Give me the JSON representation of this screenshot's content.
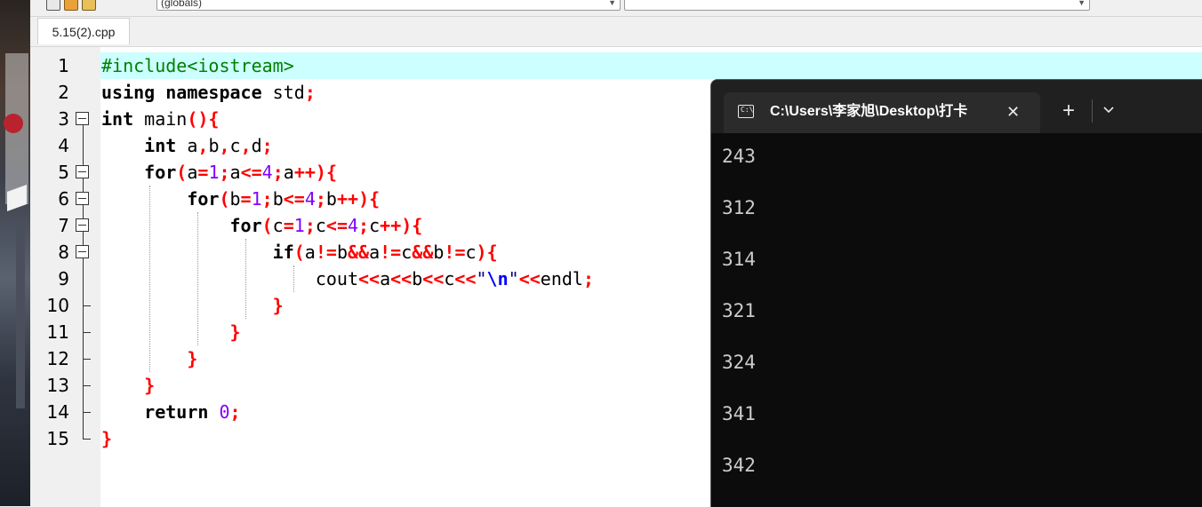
{
  "toolbar": {
    "scope_combo": "(globals)",
    "func_combo": ""
  },
  "editor": {
    "tab_label": "5.15(2).cpp",
    "line_numbers": [
      "1",
      "2",
      "3",
      "4",
      "5",
      "6",
      "7",
      "8",
      "9",
      "10",
      "11",
      "12",
      "13",
      "14",
      "15"
    ],
    "current_line_color": "#ccffff",
    "lines": [
      "#include<iostream>",
      "using namespace std;",
      "int main(){",
      "    int a,b,c,d;",
      "    for(a=1;a<=4;a++){",
      "        for(b=1;b<=4;b++){",
      "            for(c=1;c<=4;c++){",
      "                if(a!=b&&a!=c&&b!=c){",
      "                    cout<<a<<b<<c<<\"\\n\"<<endl;",
      "                }",
      "            }",
      "        }",
      "    }",
      "    return 0;",
      "}"
    ]
  },
  "terminal": {
    "title": "C:\\Users\\李家旭\\Desktop\\打卡",
    "close_glyph": "✕",
    "new_tab_glyph": "+",
    "dropdown_glyph": "⌄",
    "output": [
      "243",
      "312",
      "314",
      "321",
      "324",
      "341",
      "342"
    ]
  }
}
